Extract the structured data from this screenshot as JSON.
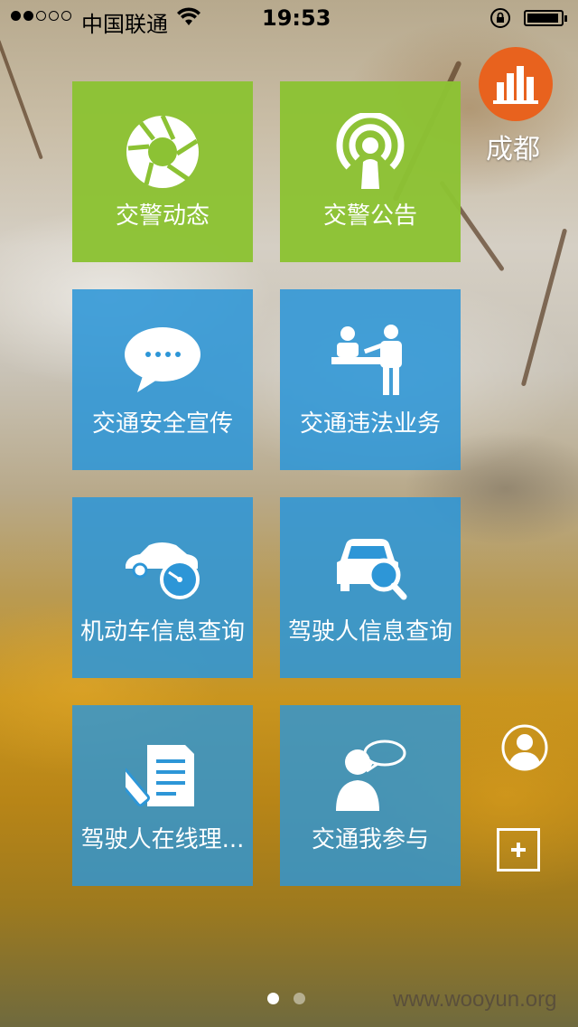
{
  "status_bar": {
    "carrier": "中国联通",
    "time": "19:53"
  },
  "city": {
    "name": "成都"
  },
  "tiles": [
    {
      "label": "交警动态",
      "icon": "shutter-icon",
      "color": "#8cc234"
    },
    {
      "label": "交警公告",
      "icon": "broadcast-icon",
      "color": "#8cc234"
    },
    {
      "label": "交通安全宣传",
      "icon": "speech-bubble-icon",
      "color": "#2d96d7"
    },
    {
      "label": "交通违法业务",
      "icon": "service-counter-icon",
      "color": "#2d96d7"
    },
    {
      "label": "机动车信息查询",
      "icon": "car-speedometer-icon",
      "color": "#2d96d7"
    },
    {
      "label": "驾驶人信息查询",
      "icon": "car-search-icon",
      "color": "#2d96d7"
    },
    {
      "label": "驾驶人在线理...",
      "icon": "document-pen-icon",
      "color": "#2d96d7"
    },
    {
      "label": "交通我参与",
      "icon": "person-chat-icon",
      "color": "#2d96d7"
    }
  ],
  "pager": {
    "pages": 2,
    "active": 1
  },
  "watermark": "www.wooyun.org"
}
